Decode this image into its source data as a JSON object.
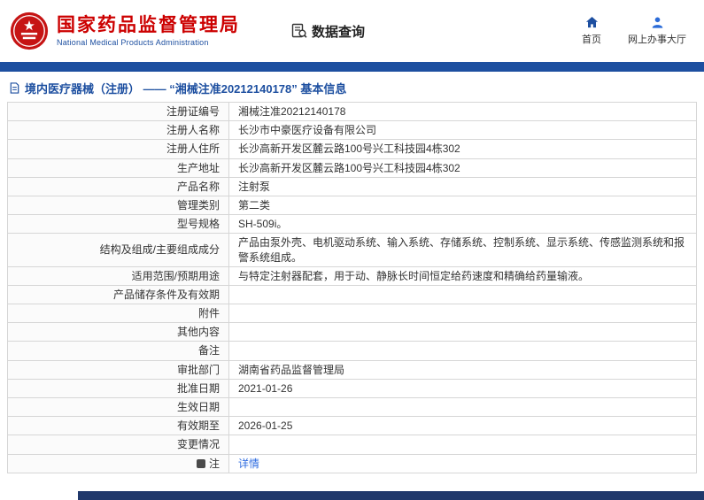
{
  "colors": {
    "brand_red": "#cc0000",
    "primary_blue": "#1d4fa0",
    "link_blue": "#2e6ce0",
    "footer_navy": "#20386b"
  },
  "header": {
    "org_name_cn": "国家药品监督管理局",
    "org_name_en": "National Medical Products Administration",
    "data_query_label": "数据查询",
    "nav": [
      {
        "label": "首页",
        "icon": "home-icon"
      },
      {
        "label": "网上办事大厅",
        "icon": "person-icon"
      }
    ]
  },
  "breadcrumb": {
    "text": "境内医疗器械（注册） —— “湘械注准20212140178” 基本信息"
  },
  "table": {
    "rows": [
      {
        "label": "注册证编号",
        "value": "湘械注准20212140178"
      },
      {
        "label": "注册人名称",
        "value": "长沙市中豪医疗设备有限公司"
      },
      {
        "label": "注册人住所",
        "value": "长沙高新开发区麓云路100号兴工科技园4栋302"
      },
      {
        "label": "生产地址",
        "value": "长沙高新开发区麓云路100号兴工科技园4栋302"
      },
      {
        "label": "产品名称",
        "value": "注射泵"
      },
      {
        "label": "管理类别",
        "value": "第二类"
      },
      {
        "label": "型号规格",
        "value": "SH-509i。"
      },
      {
        "label": "结构及组成/主要组成成分",
        "value": "产品由泵外壳、电机驱动系统、输入系统、存储系统、控制系统、显示系统、传感监测系统和报警系统组成。"
      },
      {
        "label": "适用范围/预期用途",
        "value": "与特定注射器配套，用于动、静脉长时间恒定给药速度和精确给药量输液。"
      },
      {
        "label": "产品储存条件及有效期",
        "value": ""
      },
      {
        "label": "附件",
        "value": ""
      },
      {
        "label": "其他内容",
        "value": ""
      },
      {
        "label": "备注",
        "value": ""
      },
      {
        "label": "审批部门",
        "value": "湖南省药品监督管理局"
      },
      {
        "label": "批准日期",
        "value": "2021-01-26"
      },
      {
        "label": "生效日期",
        "value": ""
      },
      {
        "label": "有效期至",
        "value": "2026-01-25"
      },
      {
        "label": "变更情况",
        "value": ""
      },
      {
        "label": "注",
        "value": "详情",
        "link": true,
        "label_icon": true
      }
    ]
  }
}
